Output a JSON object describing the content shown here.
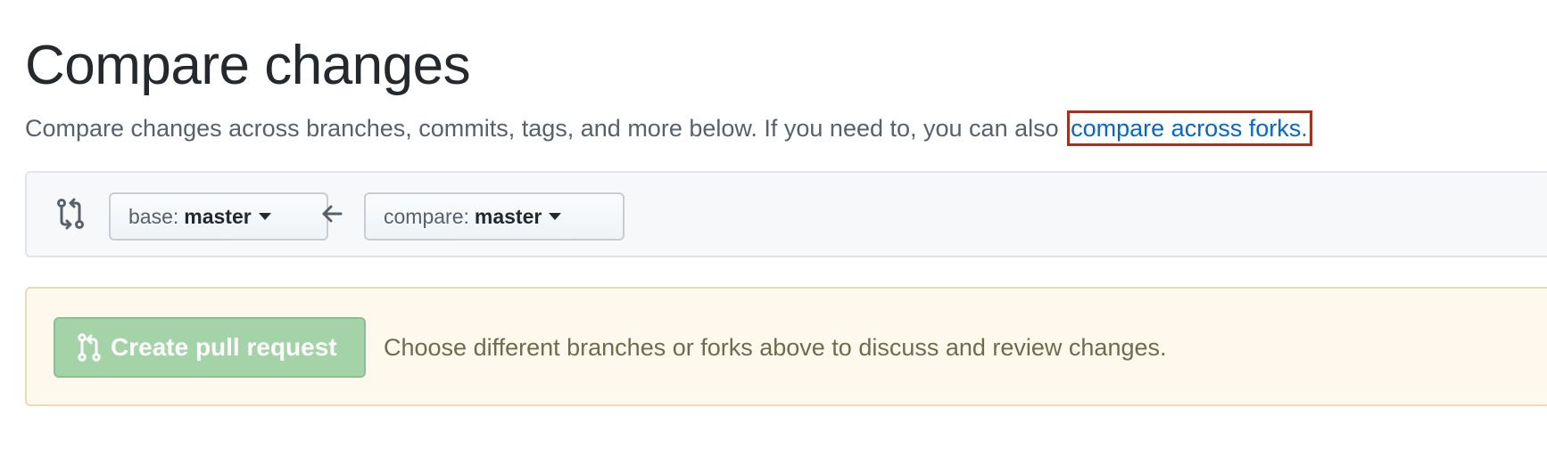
{
  "page": {
    "title": "Compare changes",
    "subtitle_text": "Compare changes across branches, commits, tags, and more below. If you need to, you can also ",
    "subtitle_link": "compare across forks",
    "subtitle_period": "."
  },
  "range": {
    "compare_icon": "git-compare-icon",
    "base_label": "base:",
    "base_value": "master",
    "arrow_icon": "arrow-left-icon",
    "compare_label": "compare:",
    "compare_value": "master"
  },
  "flash": {
    "button_icon": "git-pull-request-icon",
    "button_label": "Create pull request",
    "message": "Choose different branches or forks above to discuss and review changes."
  },
  "colors": {
    "link": "#0366d6",
    "highlight_border": "#a8301d",
    "pr_button_disabled": "#a4d3a8",
    "flash_background": "#fff8ec"
  }
}
